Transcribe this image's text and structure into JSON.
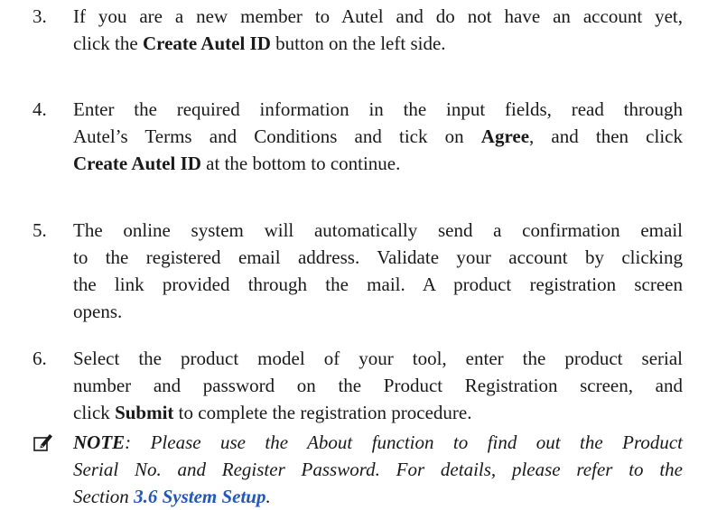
{
  "steps": [
    {
      "number": "3.",
      "lines": [
        {
          "parts": [
            "If you are a new member to Autel and do not have an account yet,"
          ]
        },
        {
          "parts": [
            "click the ",
            "Create Autel ID",
            " button on the left side."
          ]
        }
      ]
    },
    {
      "number": "4.",
      "lines": [
        {
          "parts": [
            "Enter the required information in the input fields, read through"
          ]
        },
        {
          "parts": [
            "Autel’s Terms and Conditions and tick on ",
            "Agree",
            ", and then click"
          ]
        },
        {
          "parts": [
            "Create Autel ID",
            " at the bottom to continue."
          ]
        }
      ]
    },
    {
      "number": "5.",
      "lines": [
        {
          "parts": [
            "The online system will automatically send a confirmation email"
          ]
        },
        {
          "parts": [
            "to the registered email address. Validate your account by clicking"
          ]
        },
        {
          "parts": [
            "the link provided through the mail. A product registration screen"
          ]
        },
        {
          "parts": [
            "opens."
          ]
        }
      ]
    },
    {
      "number": "6.",
      "lines": [
        {
          "parts": [
            "Select the product model of your tool, enter the product serial"
          ]
        },
        {
          "parts": [
            "number and password on the Product Registration screen, and"
          ]
        },
        {
          "parts": [
            "click ",
            "Submit",
            " to complete the registration procedure."
          ]
        }
      ]
    }
  ],
  "note": {
    "icon": "pencil-note-icon",
    "label": "NOTE",
    "line1_rest": ": Please use the About function to find out the Product",
    "line2": "Serial No. and Register Password. For details, please refer to the",
    "line3_prefix": "Section ",
    "link_text": "3.6 System Setup",
    "line3_suffix": "."
  },
  "colors": {
    "text": "#1a1a1a",
    "link": "#1f56c8"
  }
}
